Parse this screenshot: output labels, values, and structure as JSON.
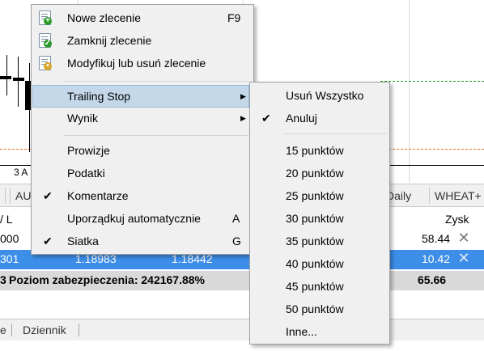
{
  "chart": {
    "date_label": "3 A"
  },
  "tabs": [
    "AU",
    "Daily",
    "WHEAT+"
  ],
  "grid": {
    "header_left": "/ L",
    "header_profit": "Zysk",
    "rows": [
      {
        "id": "000",
        "price1": "",
        "price2": "",
        "profit": "58.44"
      },
      {
        "id": "301",
        "price1": "1.18983",
        "price2": "1.18442",
        "profit": "10.42"
      }
    ],
    "summary": {
      "prefix": "3",
      "text": "Poziom zabezpieczenia: 242167.88%",
      "total": "65.66"
    }
  },
  "bottom_tabs": [
    "e",
    "Dziennik"
  ],
  "context_menu": {
    "items": [
      {
        "label": "Nowe zlecenie",
        "shortcut": "F9",
        "icon": "new-order-icon"
      },
      {
        "label": "Zamknij zlecenie",
        "shortcut": "",
        "icon": "close-order-icon"
      },
      {
        "label": "Modyfikuj lub usuń zlecenie",
        "shortcut": "",
        "icon": "modify-order-icon"
      },
      {
        "label": "Trailing Stop",
        "submenu": true,
        "highlighted": true
      },
      {
        "label": "Wynik",
        "submenu": true
      },
      {
        "label": "Prowizje"
      },
      {
        "label": "Podatki"
      },
      {
        "label": "Komentarze",
        "checked": true
      },
      {
        "label": "Uporządkuj automatycznie",
        "shortcut": "A"
      },
      {
        "label": "Siatka",
        "shortcut": "G",
        "checked": true
      }
    ]
  },
  "trailing_submenu": {
    "items": [
      {
        "label": "Usuń Wszystko"
      },
      {
        "label": "Anuluj",
        "checked": true
      },
      {
        "label": "15 punktów"
      },
      {
        "label": "20 punktów"
      },
      {
        "label": "25 punktów"
      },
      {
        "label": "30 punktów"
      },
      {
        "label": "35 punktów"
      },
      {
        "label": "40 punktów"
      },
      {
        "label": "45 punktów"
      },
      {
        "label": "50 punktów"
      },
      {
        "label": "Inne..."
      }
    ]
  },
  "colors": {
    "selected_row": "#3d8ee8",
    "menu_highlight": "#c4d8ea",
    "green_line": "#1a9a1a",
    "orange_line": "#e8702a"
  }
}
